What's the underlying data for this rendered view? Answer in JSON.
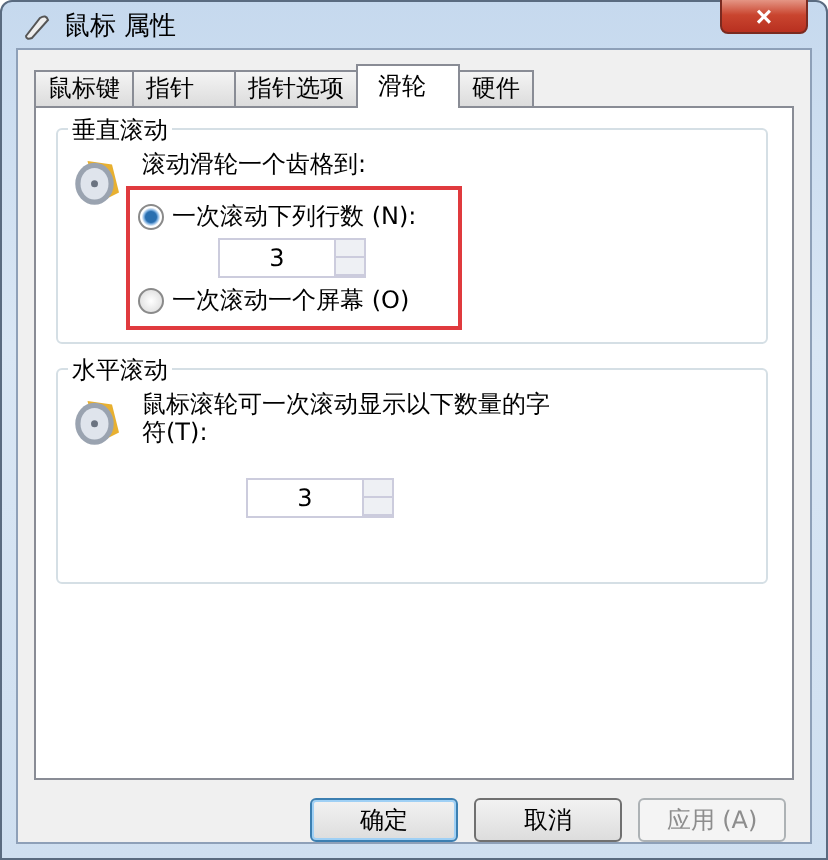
{
  "window": {
    "title": "鼠标 属性",
    "close": "×"
  },
  "tabs": [
    {
      "label": "鼠标键",
      "selected": false
    },
    {
      "label": "指针",
      "selected": false
    },
    {
      "label": "指针选项",
      "selected": false
    },
    {
      "label": "滑轮",
      "selected": true
    },
    {
      "label": "硬件",
      "selected": false
    }
  ],
  "vertical": {
    "title": "垂直滚动",
    "prompt": "滚动滑轮一个齿格到:",
    "options": [
      {
        "label": "一次滚动下列行数 (N):",
        "selected": true,
        "spinner": "3"
      },
      {
        "label": "一次滚动一个屏幕 (O)",
        "selected": false
      }
    ]
  },
  "horizontal": {
    "title": "水平滚动",
    "prompt": "鼠标滚轮可一次滚动显示以下数量的字符(T):",
    "spinner": "3"
  },
  "buttons": [
    {
      "label": "确定",
      "default": true,
      "disabled": false
    },
    {
      "label": "取消",
      "default": false,
      "disabled": false
    },
    {
      "label": "应用 (A)",
      "default": false,
      "disabled": true
    }
  ]
}
